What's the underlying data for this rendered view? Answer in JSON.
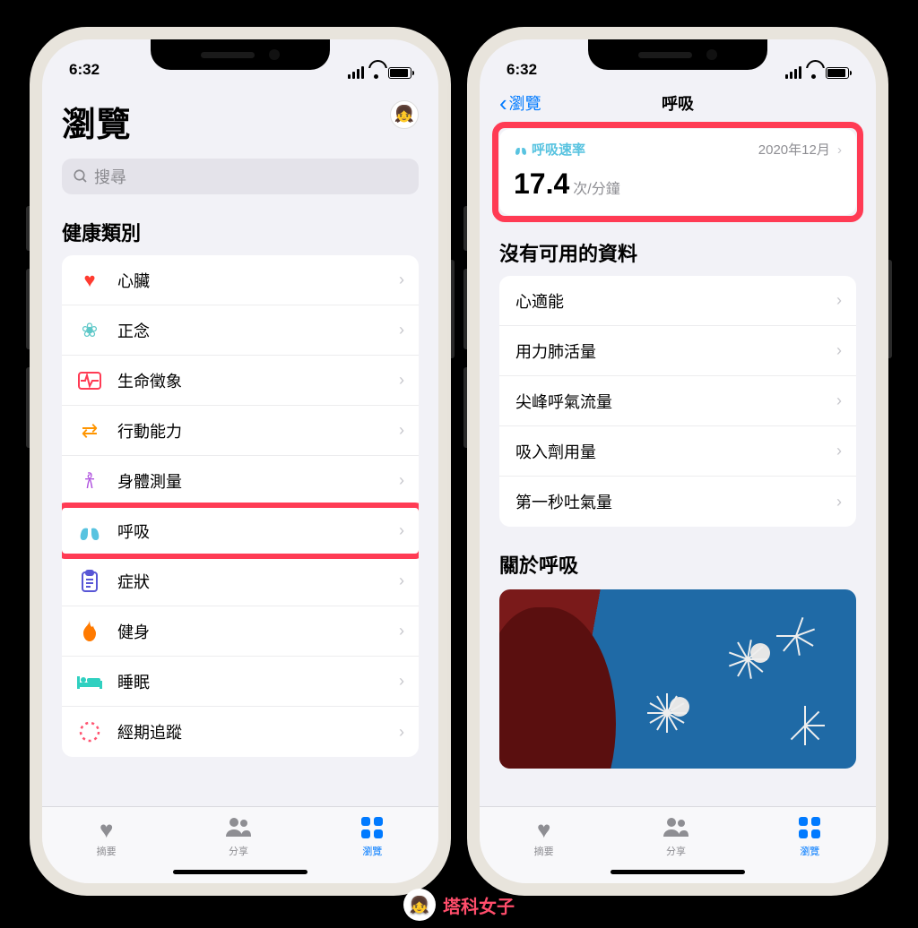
{
  "status": {
    "time": "6:32"
  },
  "left": {
    "title": "瀏覽",
    "search_placeholder": "搜尋",
    "section": "健康類別",
    "items": [
      {
        "id": "heart",
        "label": "心臟"
      },
      {
        "id": "mind",
        "label": "正念"
      },
      {
        "id": "vital",
        "label": "生命徵象"
      },
      {
        "id": "mobility",
        "label": "行動能力"
      },
      {
        "id": "body",
        "label": "身體測量"
      },
      {
        "id": "resp",
        "label": "呼吸"
      },
      {
        "id": "symptom",
        "label": "症狀"
      },
      {
        "id": "fitness",
        "label": "健身"
      },
      {
        "id": "sleep",
        "label": "睡眠"
      },
      {
        "id": "cycle",
        "label": "經期追蹤"
      }
    ]
  },
  "right": {
    "back": "瀏覽",
    "title": "呼吸",
    "rate_card": {
      "label": "呼吸速率",
      "date": "2020年12月",
      "value": "17.4",
      "unit": "次/分鐘"
    },
    "nodata_header": "沒有可用的資料",
    "nodata_items": [
      {
        "label": "心適能"
      },
      {
        "label": "用力肺活量"
      },
      {
        "label": "尖峰呼氣流量"
      },
      {
        "label": "吸入劑用量"
      },
      {
        "label": "第一秒吐氣量"
      }
    ],
    "about_header": "關於呼吸"
  },
  "tabs": [
    {
      "id": "summary",
      "label": "摘要"
    },
    {
      "id": "share",
      "label": "分享"
    },
    {
      "id": "browse",
      "label": "瀏覽"
    }
  ],
  "watermark": "塔科女子"
}
